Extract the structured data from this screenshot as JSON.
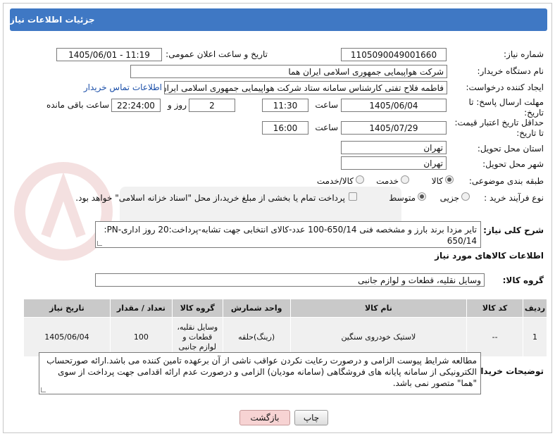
{
  "header": {
    "title": "جزئیات اطلاعات نیاز"
  },
  "need_number": {
    "label": "شماره نیاز:",
    "value": "1105090049001660"
  },
  "announce_datetime": {
    "label": "تاریخ و ساعت اعلان عمومی:",
    "value": "1405/06/01 - 11:19"
  },
  "buyer_org": {
    "label": "نام دستگاه خریدار:",
    "value": "شرکت هواپیمایی جمهوری اسلامی ایران هما"
  },
  "requester": {
    "label": "ایجاد کننده درخواست:",
    "value": "فاطمه فلاح تفتی کارشناس سامانه ستاد شرکت هواپیمایی جمهوری اسلامی ایران",
    "contact_link": "اطلاعات تماس خریدار"
  },
  "reply_deadline": {
    "label_line1": "مهلت ارسال پاسخ: تا",
    "label_line2": "تاریخ:",
    "date": "1405/06/04",
    "time_label": "ساعت",
    "time": "11:30",
    "days": "2",
    "days_label": "روز و",
    "remaining": "22:24:00",
    "remaining_label": "ساعت باقی مانده"
  },
  "price_validity": {
    "label_line1": "حداقل تاریخ اعتبار قیمت:",
    "label_line2": "تا تاریخ:",
    "date": "1405/07/29",
    "time_label": "ساعت",
    "time": "16:00"
  },
  "delivery_province": {
    "label": "استان محل تحویل:",
    "value": "تهران"
  },
  "delivery_city": {
    "label": "شهر محل تحویل:",
    "value": "تهران"
  },
  "category": {
    "label": "طبقه بندی موضوعی:",
    "options": [
      "کالا",
      "خدمت",
      "کالا/خدمت"
    ],
    "selected": "کالا"
  },
  "purchase_type": {
    "label": "نوع فرآیند خرید :",
    "options": [
      "جزیی",
      "متوسط"
    ],
    "selected": "متوسط",
    "note": "پرداخت تمام یا بخشی از مبلغ خرید،از محل \"اسناد خزانه اسلامی\" خواهد بود."
  },
  "summary": {
    "label": "شرح کلی نیاز:",
    "line1": "تایر مزدا برند بارز و مشخصه فنی 650/14-100 عدد-کالای انتخابی جهت تشابه-پرداخت:20 روز اداری-PN:",
    "line2": "650/14"
  },
  "goods_info": {
    "title": "اطلاعات کالاهای مورد نیاز"
  },
  "goods_group": {
    "label": "گروه کالا:",
    "value": "وسایل نقلیه، قطعات و لوازم جانبی"
  },
  "table": {
    "headers": [
      "ردیف",
      "کد کالا",
      "نام کالا",
      "واحد شمارش",
      "گروه کالا",
      "تعداد / مقدار",
      "تاریخ نیاز"
    ],
    "rows": [
      {
        "row": "1",
        "code": "--",
        "name": "لاستیک خودروی سنگین",
        "unit": "(رینگ)حلقه",
        "group": "وسایل نقلیه، قطعات و لوازم جانبی",
        "qty": "100",
        "date": "1405/06/04"
      }
    ]
  },
  "buyer_notes": {
    "label": "توضیحات خریدار:",
    "text": "مطالعه شرایط پیوست الزامی و درصورت رعایت نکردن عواقب ناشی از آن برعهده تامین کننده می باشد.ارائه صورتحساب الکترونیکی از سامانه پایانه های فروشگاهی (سامانه مودیان) الزامی و درصورت عدم ارائه اقدامی جهت پرداخت از سوی \"هما\" متصور نمی باشد."
  },
  "buttons": {
    "print": "چاپ",
    "back": "بازگشت"
  },
  "colors": {
    "header_bg": "#3f78c4",
    "link": "#1a4ea8",
    "back_button": "#f7d3d3"
  }
}
